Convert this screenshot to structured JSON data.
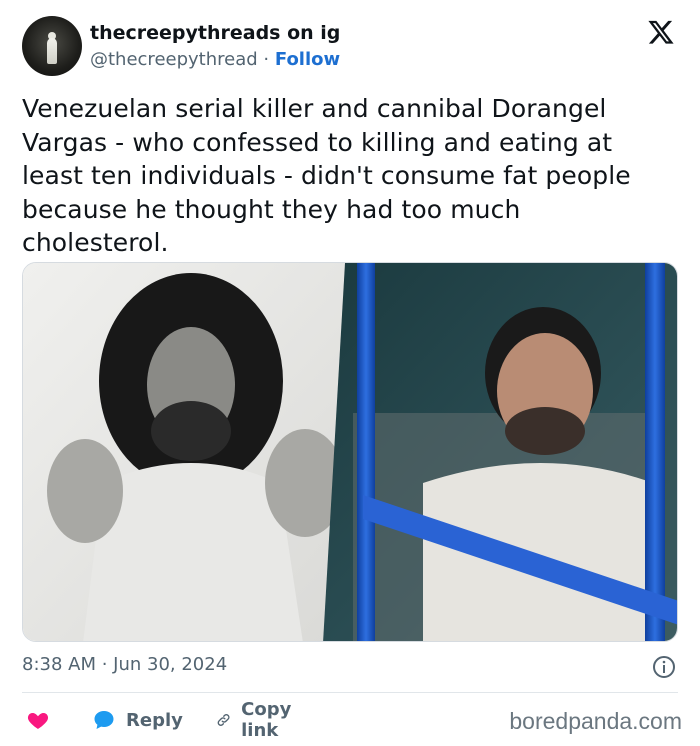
{
  "author": {
    "display_name": "thecreepythreads on ig",
    "handle": "@thecreepythread",
    "separator": "·",
    "follow_label": "Follow"
  },
  "tweet": {
    "text": "Venezuelan serial killer and cannibal Dorangel Vargas - who confessed to killing and eating at least ten individuals - didn't consume fat people because he thought they had too much cholesterol.",
    "timestamp": "8:38 AM · Jun 30, 2024"
  },
  "actions": {
    "like_icon": "heart-icon",
    "reply_label": "Reply",
    "copy_label": "Copy link"
  },
  "watermark": "boredpanda.com",
  "colors": {
    "follow": "#1d6fd1",
    "heart": "#f91880",
    "reply_icon": "#1d9bf0",
    "muted": "#536471"
  }
}
